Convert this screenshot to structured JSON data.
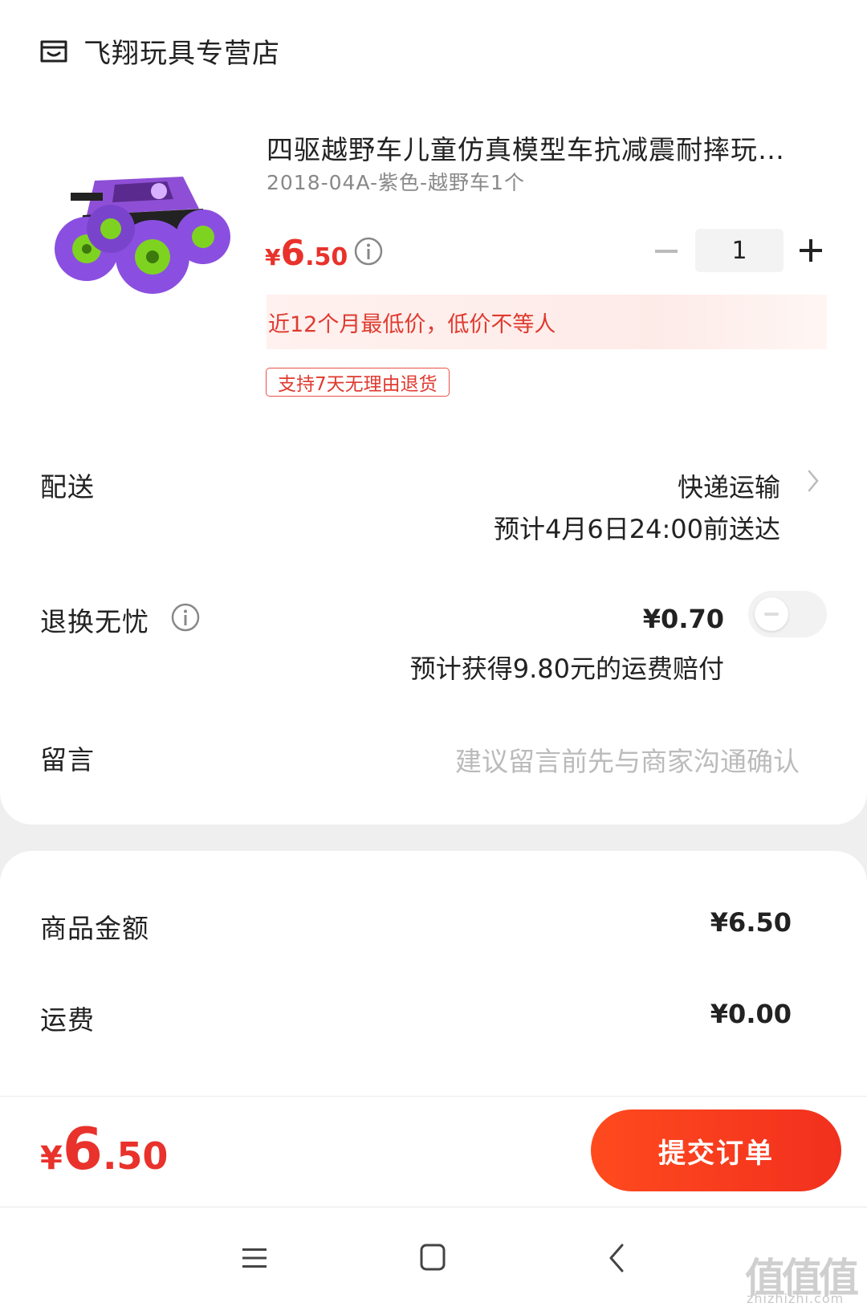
{
  "store": {
    "name": "飞翔玩具专营店",
    "icon": "store-icon"
  },
  "product": {
    "title": "四驱越野车儿童仿真模型车抗减震耐摔玩…",
    "spec": "2018-04A-紫色-越野车1个",
    "price": {
      "currency": "¥",
      "integer": "6",
      "decimal": ".50"
    },
    "quantity": "1",
    "lowest_price_note": "近12个月最低价，低价不等人",
    "return_tag": "支持7天无理由退货"
  },
  "delivery": {
    "label": "配送",
    "method": "快递运输",
    "eta": "预计4月6日24:00前送达"
  },
  "refund_insurance": {
    "label": "退换无忧",
    "price": "¥0.70",
    "note": "预计获得9.80元的运费赔付",
    "enabled": false
  },
  "message": {
    "label": "留言",
    "placeholder": "建议留言前先与商家沟通确认"
  },
  "summary": {
    "goods_label": "商品金额",
    "goods_value": "¥6.50",
    "shipping_label": "运费",
    "shipping_value": "¥0.00"
  },
  "footer": {
    "total": {
      "currency": "¥",
      "integer": "6",
      "decimal": ".50"
    },
    "submit_label": "提交订单"
  },
  "colors": {
    "accent": "#e8322b",
    "button": "#f2301e"
  },
  "watermark": {
    "main": "值值值",
    "sub": "zhizhizhi.com"
  }
}
